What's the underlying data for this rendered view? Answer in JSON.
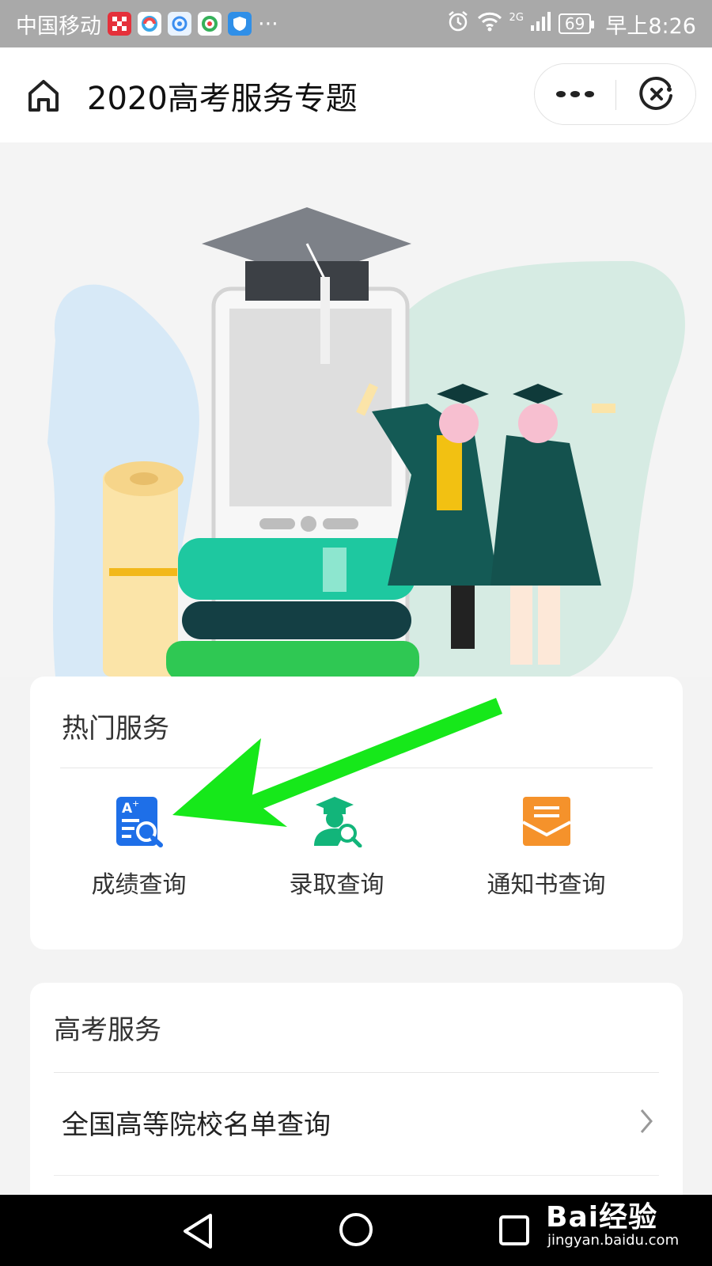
{
  "status_bar": {
    "carrier": "中国移动",
    "more": "···",
    "network": "2G",
    "battery": "69",
    "time": "早上8:26"
  },
  "nav": {
    "title": "2020高考服务专题",
    "more_glyph": "•••"
  },
  "hot_services": {
    "title": "热门服务",
    "items": [
      {
        "label": "成绩查询",
        "icon": "score-search-icon",
        "color": "#1e6fe8"
      },
      {
        "label": "录取查询",
        "icon": "graduate-search-icon",
        "color": "#12b57a"
      },
      {
        "label": "通知书查询",
        "icon": "envelope-icon",
        "color": "#f5922b"
      }
    ]
  },
  "gaokao_services": {
    "title": "高考服务",
    "rows": [
      {
        "label": "全国高等院校名单查询"
      }
    ]
  },
  "annotation": {
    "color": "#16e81a"
  },
  "watermark": {
    "main": "Bai经验",
    "sub": "jingyan.baidu.com"
  }
}
